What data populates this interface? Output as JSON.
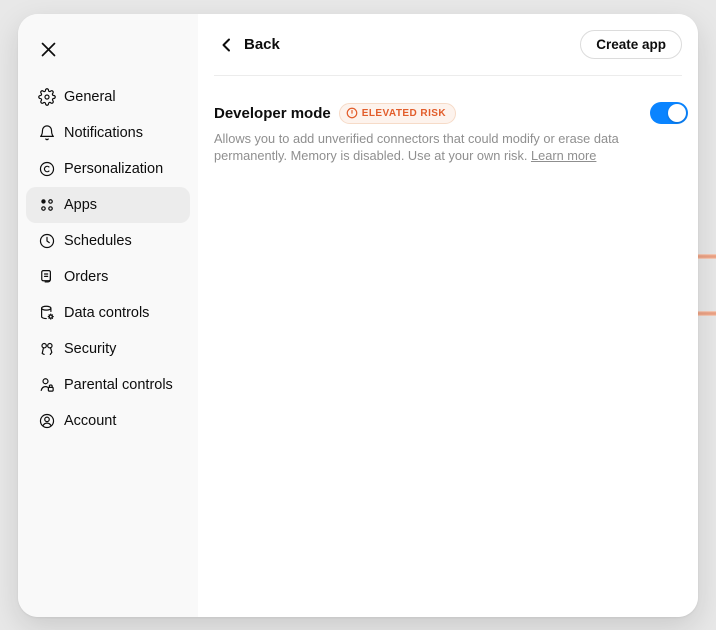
{
  "colors": {
    "accent_blue": "#0a84ff",
    "risk_orange": "#e25d2b",
    "risk_badge_bg": "#fdf3ed",
    "risk_badge_border": "#f6dbc8",
    "background_stripe": "#eda284"
  },
  "sidebar": {
    "items": [
      {
        "label": "General",
        "icon": "gear-icon",
        "selected": false
      },
      {
        "label": "Notifications",
        "icon": "bell-icon",
        "selected": false
      },
      {
        "label": "Personalization",
        "icon": "personalization-icon",
        "selected": false
      },
      {
        "label": "Apps",
        "icon": "apps-grid-icon",
        "selected": true
      },
      {
        "label": "Schedules",
        "icon": "clock-icon",
        "selected": false
      },
      {
        "label": "Orders",
        "icon": "receipt-icon",
        "selected": false
      },
      {
        "label": "Data controls",
        "icon": "database-gear-icon",
        "selected": false
      },
      {
        "label": "Security",
        "icon": "keys-icon",
        "selected": false
      },
      {
        "label": "Parental controls",
        "icon": "person-lock-icon",
        "selected": false
      },
      {
        "label": "Account",
        "icon": "person-circle-icon",
        "selected": false
      }
    ]
  },
  "header": {
    "back_label": "Back",
    "create_app_label": "Create app"
  },
  "developer_mode": {
    "title": "Developer mode",
    "risk_badge": "ELEVATED RISK",
    "description": "Allows you to add unverified connectors that could modify or erase data permanently. Memory is disabled. Use at your own risk.",
    "learn_more": "Learn more",
    "enabled": true
  }
}
